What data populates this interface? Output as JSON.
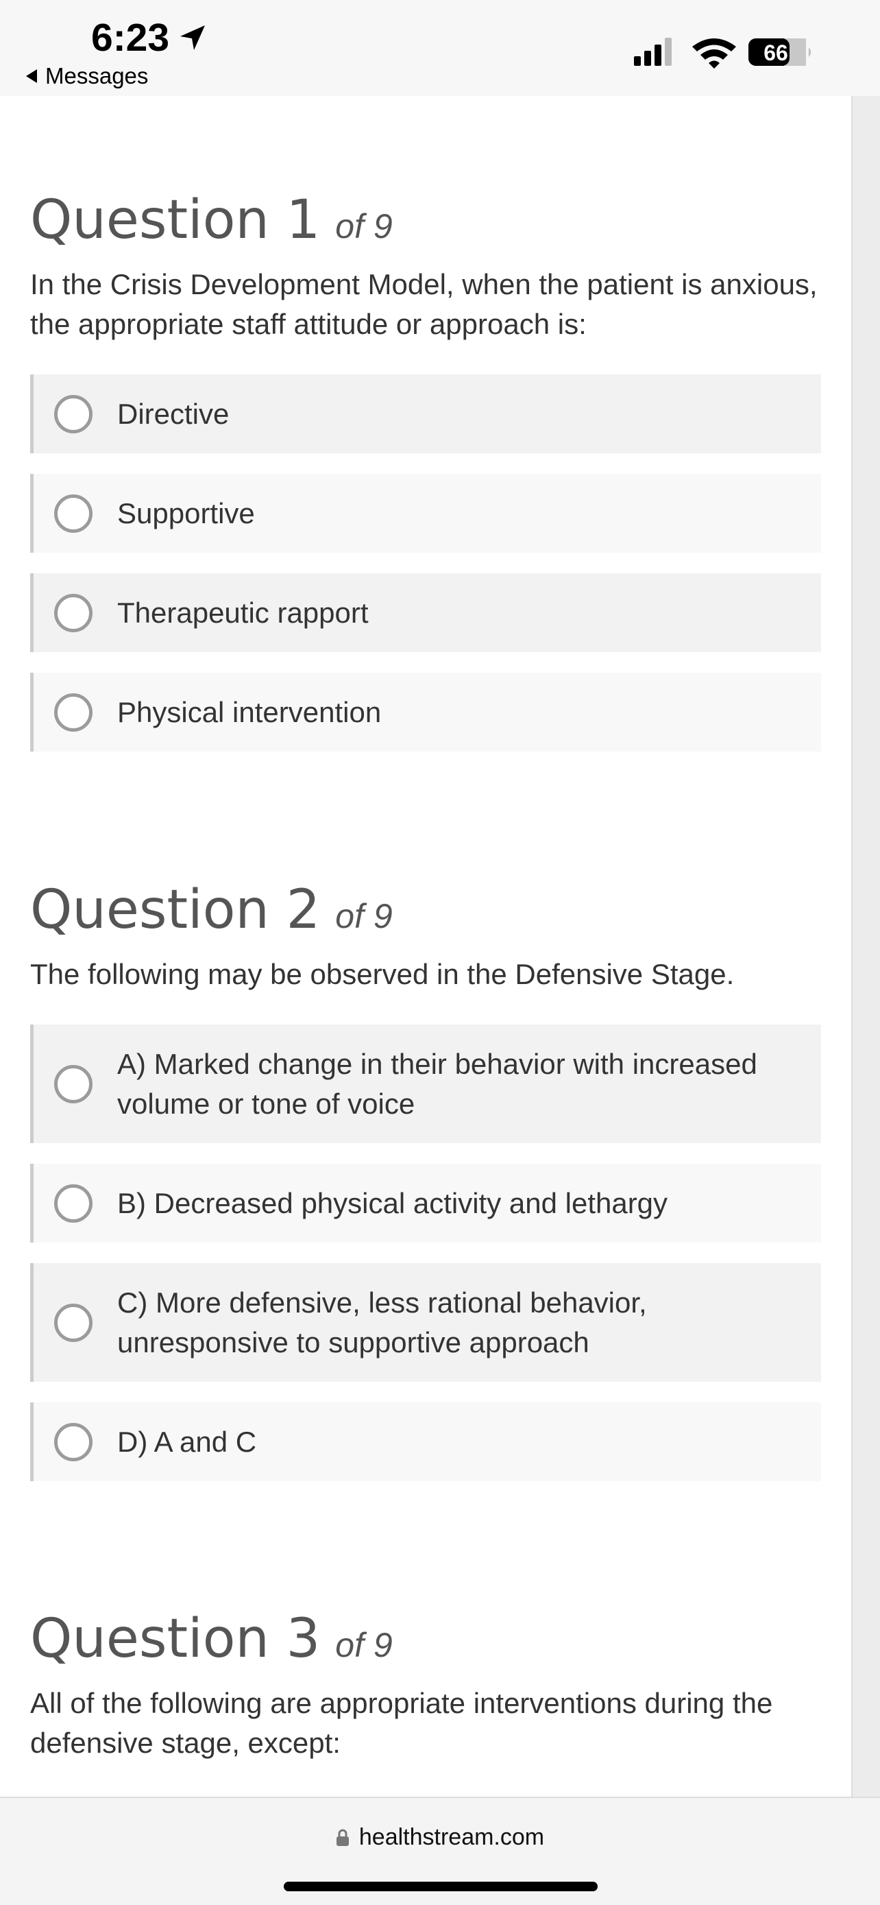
{
  "status_bar": {
    "time": "6:23",
    "back_label": "Messages",
    "battery": "66"
  },
  "questions": [
    {
      "title": "Question 1",
      "of": "of 9",
      "text": "In the Crisis Development Model, when the patient is anxious, the appropriate staff attitude or approach is:",
      "options": [
        "Directive",
        "Supportive",
        "Therapeutic rapport",
        "Physical intervention"
      ]
    },
    {
      "title": "Question 2",
      "of": "of 9",
      "text": "The following may be observed in the Defensive Stage.",
      "options": [
        "A) Marked change in their behavior with increased volume or tone of voice",
        "B) Decreased physical activity and lethargy",
        "C) More defensive, less rational behavior, unresponsive to supportive approach",
        "D) A and C"
      ]
    },
    {
      "title": "Question 3",
      "of": "of 9",
      "text": "All of the following are appropriate interventions during the defensive stage, except:"
    }
  ],
  "browser": {
    "url": "healthstream.com"
  },
  "colors": {
    "option_bg_a": "#f2f2f2",
    "option_bg_b": "#f8f8f8",
    "radio_border": "#9b9b9b"
  }
}
